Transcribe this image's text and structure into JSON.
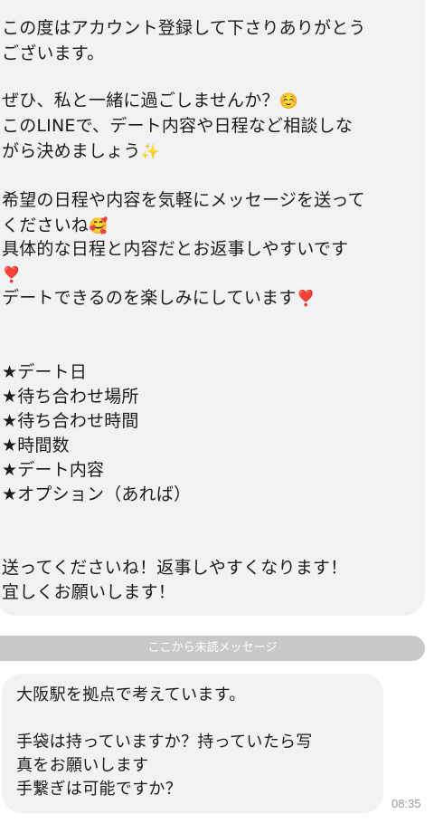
{
  "chat": {
    "message1": {
      "lines": [
        "この度はアカウント登録して下さりありがとう",
        "ございます。",
        "ぜひ、私と一緒に過ごしませんか？",
        "このLINEで、デート内容や日程など相談しな",
        "がら決めましょう",
        "希望の日程や内容を気軽にメッセージを送って",
        "くださいね",
        "具体的な日程と内容だとお返事しやすいです",
        "デートできるのを楽しみにしています",
        "★デート日",
        "★待ち合わせ場所",
        "★待ち合わせ時間",
        "★時間数",
        "★デート内容",
        "★オプション（あれば）",
        "送ってくださいね！返事しやすくなります！",
        "宜しくお願いします！"
      ],
      "emojis": {
        "smile": "☺️",
        "sparkles": "✨",
        "hearts_face": "🥰",
        "heart_exclaim": "❣️"
      }
    },
    "unread_divider": "ここから未読メッセージ",
    "message2": {
      "lines": [
        "大阪駅を拠点で考えています。",
        "手袋は持っていますか？持っていたら写",
        "真をお願いします",
        "手繋ぎは可能ですか？"
      ],
      "time": "08:35"
    }
  }
}
